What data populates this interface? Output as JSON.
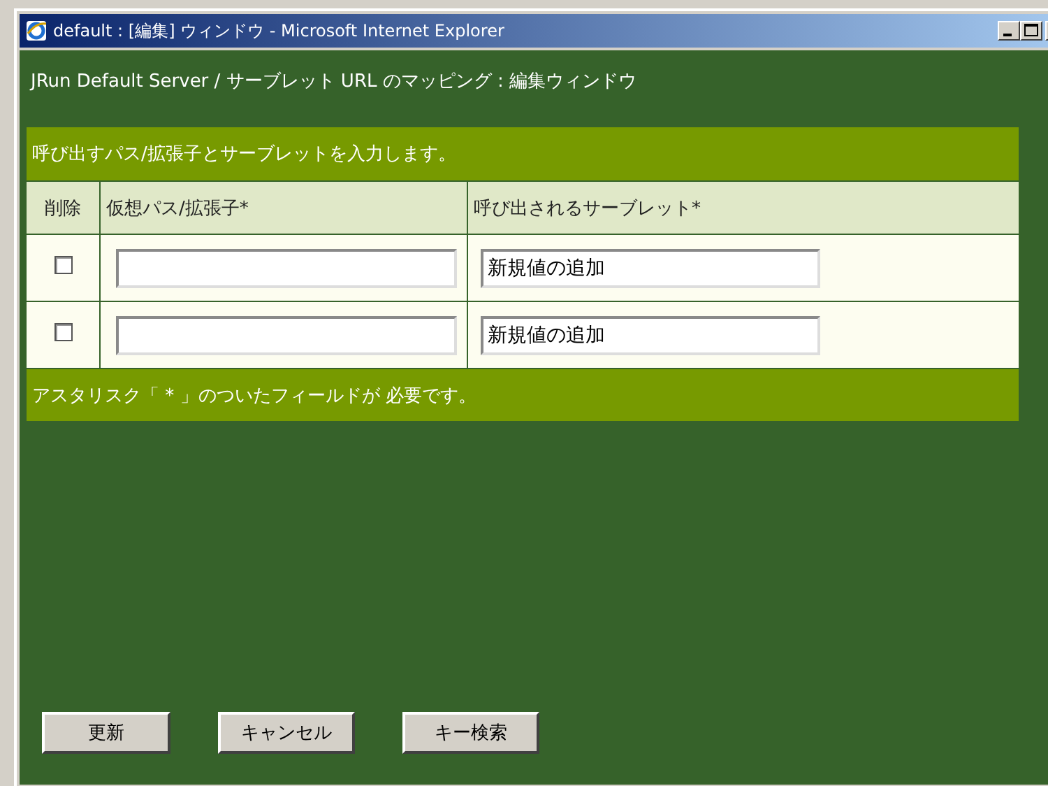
{
  "window": {
    "title": "default : [編集] ウィンドウ - Microsoft Internet Explorer"
  },
  "heading": "JRun Default Server / サーブレット URL のマッピング : 編集ウィンドウ",
  "form": {
    "instruction": "呼び出すパス/拡張子とサーブレットを入力します。",
    "columns": [
      "削除",
      "仮想パス/拡張子*",
      "呼び出されるサーブレット*"
    ],
    "rows": [
      {
        "checked": false,
        "servlet": "新規値の追加"
      },
      {
        "checked": false,
        "servlet": "新規値の追加"
      }
    ],
    "note": "アスタリスク「 * 」のついたフィールドが 必要です。"
  },
  "buttons": [
    "更新",
    "キャンセル",
    "キー検索"
  ]
}
